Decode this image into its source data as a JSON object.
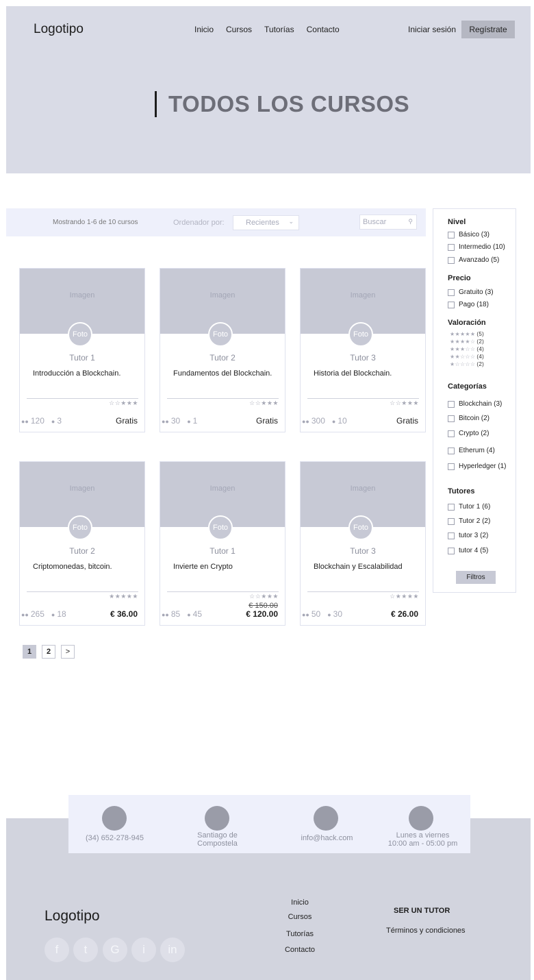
{
  "header": {
    "logo": "Logotipo",
    "nav": [
      "Inicio",
      "Cursos",
      "Tutorías",
      "Contacto"
    ],
    "login": "Iniciar sesión",
    "register": "Regístrate"
  },
  "hero": {
    "title": "TODOS LOS CURSOS"
  },
  "toolbar": {
    "showing": "Mostrando 1-6 de 10 cursos",
    "sort_label": "Ordenador por:",
    "sort_value": "Recientes",
    "search_placeholder": "Buscar"
  },
  "cards": [
    {
      "image": "Imagen",
      "photo": "Foto",
      "tutor": "Tutor 1",
      "title": "Introducción a Blockchain.",
      "stars": "☆☆★★★",
      "students": "120",
      "comments": "3",
      "price": "Gratis",
      "old_price": ""
    },
    {
      "image": "Imagen",
      "photo": "Foto",
      "tutor": "Tutor 2",
      "title": "Fundamentos del Blockchain.",
      "stars": "☆☆★★★",
      "students": "30",
      "comments": "1",
      "price": "Gratis",
      "old_price": ""
    },
    {
      "image": "Imagen",
      "photo": "Foto",
      "tutor": "Tutor 3",
      "title": "Historia del Blockchain.",
      "stars": "☆☆★★★",
      "students": "300",
      "comments": "10",
      "price": "Gratis",
      "old_price": ""
    },
    {
      "image": "Imagen",
      "photo": "Foto",
      "tutor": "Tutor 2",
      "title": "Criptomonedas, bitcoin.",
      "stars": "★★★★★",
      "students": "265",
      "comments": "18",
      "price": "€ 36.00",
      "old_price": ""
    },
    {
      "image": "Imagen",
      "photo": "Foto",
      "tutor": "Tutor 1",
      "title": "Invierte en Crypto",
      "stars": "☆☆★★★",
      "students": "85",
      "comments": "45",
      "price": "€ 120.00",
      "old_price": "€ 150.00"
    },
    {
      "image": "Imagen",
      "photo": "Foto",
      "tutor": "Tutor 3",
      "title": "Blockchain y Escalabilidad",
      "stars": "☆★★★★",
      "students": "50",
      "comments": "30",
      "price": "€ 26.00",
      "old_price": ""
    }
  ],
  "pagination": {
    "pages": [
      "1",
      "2"
    ],
    "next": ">",
    "current": "1"
  },
  "sidebar": {
    "level_title": "Nivel",
    "level": [
      "Básico (3)",
      "Intermedio (10)",
      "Avanzado (5)"
    ],
    "price_title": "Precio",
    "price": [
      "Gratuito (3)",
      "Pago (18)"
    ],
    "rating_title": "Valoración",
    "ratings": [
      {
        "stars": "★★★★★",
        "count": "(5)"
      },
      {
        "stars": "★★★★☆",
        "count": "(2)"
      },
      {
        "stars": "★★★☆☆",
        "count": "(4)"
      },
      {
        "stars": "★★☆☆☆",
        "count": "(4)"
      },
      {
        "stars": "★☆☆☆☆",
        "count": "(2)"
      }
    ],
    "categories_title": "Categorías",
    "categories": [
      "Blockchain (3)",
      "Bitcoin (2)",
      "Crypto (2)",
      "Etherum (4)",
      "Hyperledger (1)"
    ],
    "tutors_title": "Tutores",
    "tutors": [
      "Tutor 1 (6)",
      "Tutor 2 (2)",
      "tutor 3 (2)",
      "tutor 4 (5)"
    ],
    "filter_button": "Filtros"
  },
  "contact": {
    "phone": "(34) 652-278-945",
    "city_line1": "Santiago de",
    "city_line2": "Compostela",
    "email": "info@hack.com",
    "hours_line1": "Lunes a viernes",
    "hours_line2": "10:00 am - 05:00 pm"
  },
  "footer": {
    "logo": "Logotipo",
    "social": [
      "f",
      "t",
      "G",
      "i",
      "in"
    ],
    "links": [
      "Inicio",
      "Cursos",
      "Tutorías",
      "Contacto"
    ],
    "become_tutor": "SER UN TUTOR",
    "terms": "Términos y condiciones"
  },
  "colors": {
    "header_bg": "#d9dbe6",
    "placeholder": "#c7c9d5",
    "toolbar_bg": "#eef0fb",
    "footer_bg": "#d2d4de"
  }
}
